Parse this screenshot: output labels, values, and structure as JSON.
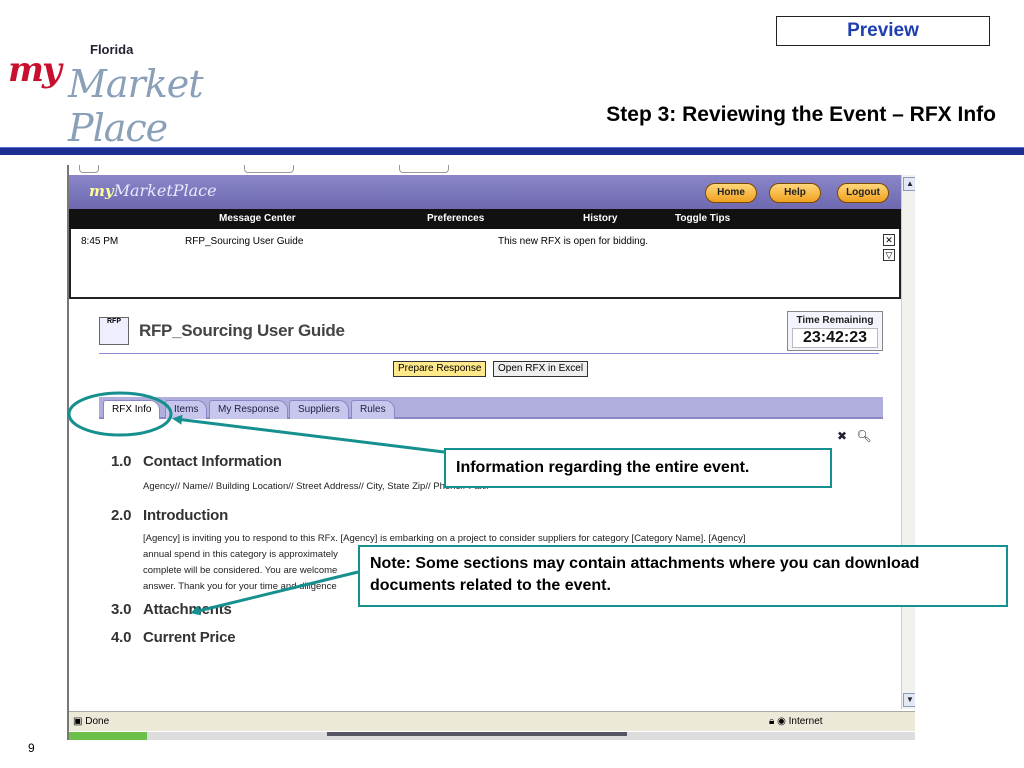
{
  "slide": {
    "preview_label": "Preview",
    "title": "Step 3: Reviewing the Event – RFX Info",
    "page_number": "9",
    "logo": {
      "my": "my",
      "florida": "Florida",
      "market_place": "Market Place"
    }
  },
  "app": {
    "logo_my": "my",
    "logo_rest": "MarketPlace",
    "nav_buttons": {
      "home": "Home",
      "help": "Help",
      "logout": "Logout"
    },
    "menu": {
      "message_center": "Message Center",
      "preferences": "Preferences",
      "history": "History",
      "toggle_tips": "Toggle Tips"
    },
    "message": {
      "time": "8:45 PM",
      "subject": "RFP_Sourcing User Guide",
      "text": "This new RFX is open for bidding."
    },
    "event_title": "RFP_Sourcing User Guide",
    "rfp_icon_label": "RFP",
    "time_remaining": {
      "label": "Time Remaining",
      "value": "23:42:23"
    },
    "actions": {
      "prepare_response": "Prepare Response",
      "open_excel": "Open RFX in Excel"
    },
    "tabs": [
      {
        "label": "RFX Info"
      },
      {
        "label": "Items"
      },
      {
        "label": "My Response"
      },
      {
        "label": "Suppliers"
      },
      {
        "label": "Rules"
      }
    ],
    "sections": [
      {
        "num": "1.0",
        "title": "Contact Information"
      },
      {
        "num": "2.0",
        "title": "Introduction"
      },
      {
        "num": "3.0",
        "title": "Attachments"
      },
      {
        "num": "4.0",
        "title": "Current Price"
      }
    ],
    "contact_text": "Agency// Name// Building Location// Street Address// City, State Zip// Phone// Fax//",
    "intro_lines": [
      "[Agency] is inviting you to respond to this RFx. [Agency] is embarking on a project to consider suppliers for category [Category Name]. [Agency]",
      "annual spend in this category is approximately",
      "complete will be considered. You are welcome",
      "answer. Thank you for your time and diligence"
    ],
    "status": {
      "done": "Done",
      "zone": "Internet"
    }
  },
  "callouts": {
    "info": "Information regarding the entire event.",
    "note": "Note: Some sections may contain attachments where you can download documents related to the event."
  },
  "colors": {
    "accent_teal": "#168f8f",
    "header_blue": "#1a2f8f",
    "app_purple": "#7e7abd",
    "preview_blue": "#1f3fb0"
  }
}
